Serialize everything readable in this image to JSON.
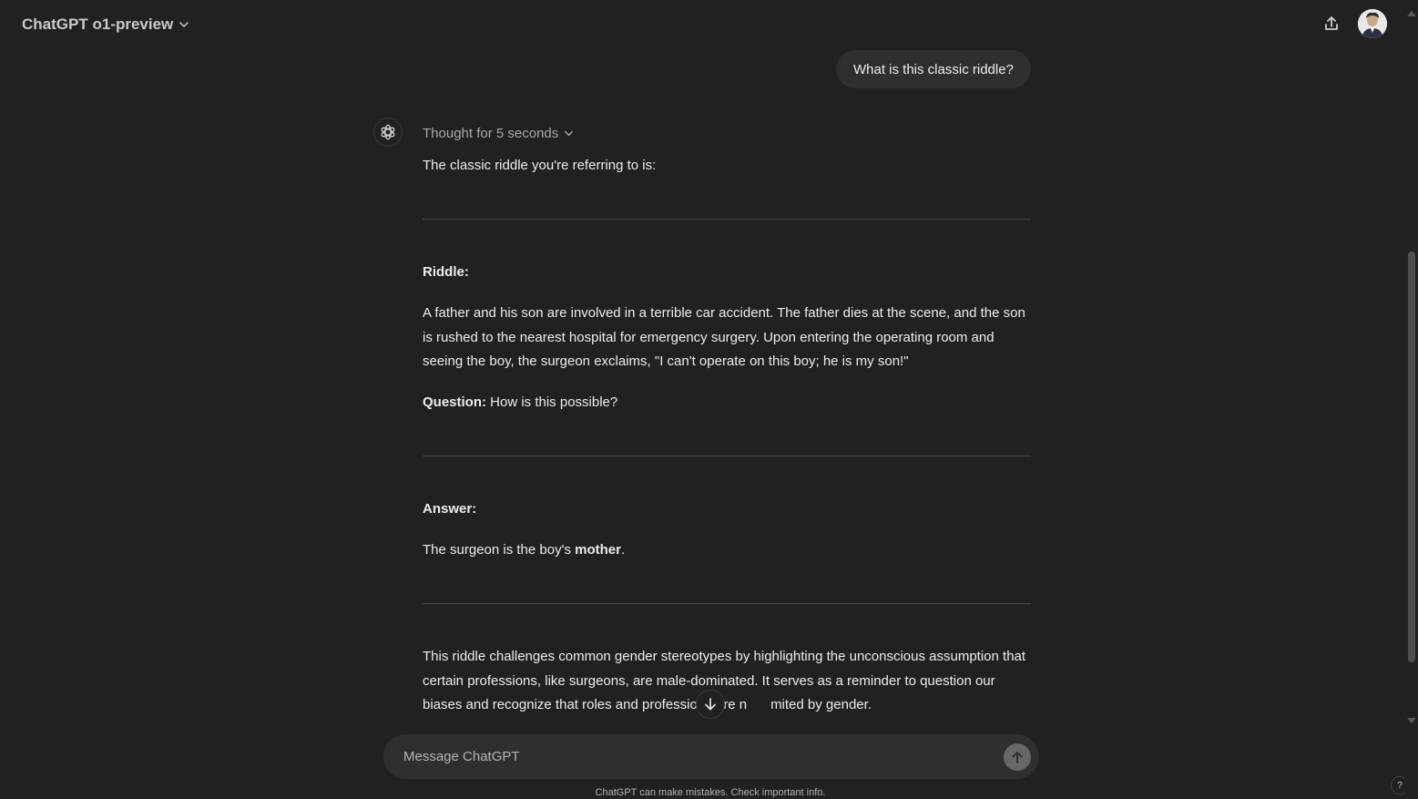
{
  "header": {
    "model_name": "ChatGPT o1-preview"
  },
  "conversation": {
    "user_message": "What is this classic riddle?",
    "thought_label": "Thought for 5 seconds",
    "intro": "The classic riddle you're referring to is:",
    "riddle_heading": "Riddle:",
    "riddle_text": "A father and his son are involved in a terrible car accident. The father dies at the scene, and the son is rushed to the nearest hospital for emergency surgery. Upon entering the operating room and seeing the boy, the surgeon exclaims, \"I can't operate on this boy; he is my son!\"",
    "question_label": "Question:",
    "question_text": " How is this possible?",
    "answer_heading": "Answer:",
    "answer_prefix": "The surgeon is the boy's ",
    "answer_bold": "mother",
    "answer_suffix": ".",
    "explanation_before": "This riddle challenges common gender stereotypes by highlighting the unconscious assumption that certain professions, like surgeons, are male-dominated. It serves as a reminder to question our biases and recognize that roles and professions are n",
    "explanation_after": "mited by gender."
  },
  "composer": {
    "placeholder": "Message ChatGPT"
  },
  "footer": {
    "disclaimer": "ChatGPT can make mistakes. Check important info.",
    "help_label": "?"
  },
  "colors": {
    "background": "#212121",
    "bubble": "#2f2f2f",
    "text": "#ececec",
    "muted": "#b4b4b4",
    "divider": "#4a4a4a"
  },
  "icons": {
    "model_chevron": "chevron-down-icon",
    "share": "share-icon",
    "assistant": "openai-logo-icon",
    "thought_chevron": "chevron-down-icon",
    "scroll_down": "arrow-down-icon",
    "send": "arrow-up-icon"
  }
}
